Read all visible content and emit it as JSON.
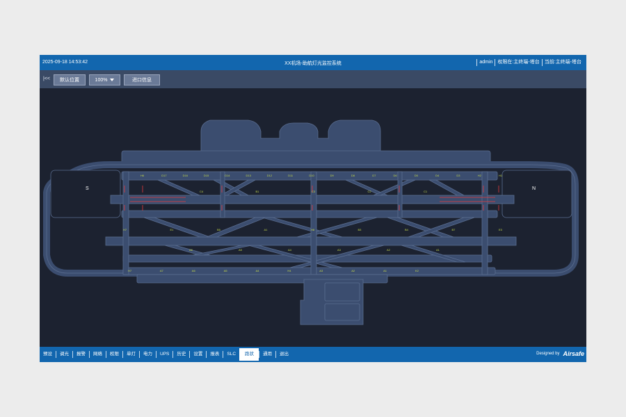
{
  "header": {
    "datetime": "2025-09-18 14:53:42",
    "title": "XX机场-助航灯光监控系统",
    "user": "admin",
    "permission": "权限在:主终端-塔台",
    "current": "当前:主终端-塔台"
  },
  "toolbar": {
    "first_label": "|<<",
    "default_pos_label": "默认位置",
    "zoom_value": "100%",
    "entry_info_label": "进口信息"
  },
  "map": {
    "south_label": "S",
    "north_label": "N",
    "taxi_labels_top": [
      "H6",
      "D17",
      "D16",
      "D15",
      "D14",
      "D13",
      "D12",
      "D11",
      "D10",
      "D9",
      "D8",
      "D7",
      "D6",
      "D5",
      "D4",
      "D3",
      "H2",
      "H1"
    ],
    "taxi_labels_mid": [
      "C4",
      "B1",
      "C3",
      "C2",
      "C1"
    ],
    "taxi_labels_lower": [
      "H7",
      "E1",
      "B5",
      "A1",
      "H8",
      "B3",
      "B4",
      "B7",
      "E3"
    ],
    "taxi_labels_low": [
      "A6",
      "A5",
      "A4",
      "A3",
      "A2",
      "A1"
    ],
    "taxi_labels_bottom": [
      "H7",
      "A7",
      "A6",
      "A5",
      "A4",
      "H4",
      "A3",
      "A2",
      "A1",
      "K2"
    ],
    "colors": {
      "background": "#1c2230",
      "pavement": "#3b4d6f",
      "pavement_stroke": "#5a6d90",
      "runway_light": "#e83a3a",
      "label": "#c8dc4a"
    }
  },
  "bottom_tabs": [
    "预设",
    "调光",
    "报警",
    "网络",
    "权限",
    "单灯",
    "电力",
    "UPS",
    "历史",
    "设置",
    "报表",
    "SLC",
    "跑状",
    "通用",
    "退出"
  ],
  "active_tab": "跑状",
  "footer": {
    "designed_by": "Designed by",
    "brand": "Airsafe"
  }
}
